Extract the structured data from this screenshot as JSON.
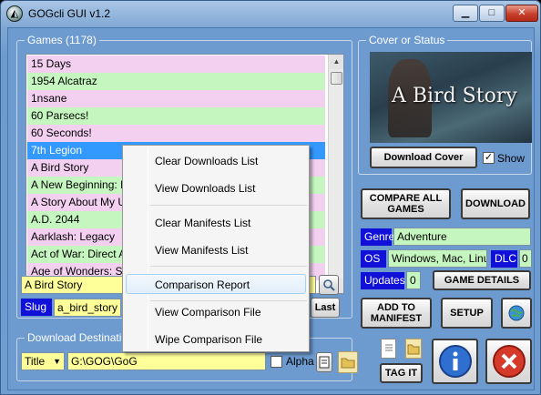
{
  "window": {
    "title": "GOGcli GUI v1.2",
    "minimize_glyph": "▁",
    "maximize_glyph": "□",
    "close_glyph": "✕"
  },
  "games": {
    "group_label": "Games  (1178)",
    "rows": [
      {
        "label": "15 Days",
        "style": "pink"
      },
      {
        "label": "1954 Alcatraz",
        "style": "green"
      },
      {
        "label": "1nsane",
        "style": "pink"
      },
      {
        "label": "60 Parsecs!",
        "style": "green"
      },
      {
        "label": "60 Seconds!",
        "style": "pink"
      },
      {
        "label": "7th Legion",
        "style": "sel"
      },
      {
        "label": "A Bird Story",
        "style": "pink"
      },
      {
        "label": "A New Beginning: F",
        "style": "green"
      },
      {
        "label": "A Story About My U",
        "style": "pink"
      },
      {
        "label": "A.D. 2044",
        "style": "green"
      },
      {
        "label": "Aarklash: Legacy",
        "style": "pink"
      },
      {
        "label": "Act of War: Direct A",
        "style": "green"
      },
      {
        "label": "Age of Wonders: Sh",
        "style": "pink"
      }
    ],
    "title_field": "A Bird Story",
    "slug_label": "Slug",
    "slug_value": "a_bird_story",
    "last_button": "Last"
  },
  "context_menu": {
    "items": [
      {
        "label": "Clear Downloads List"
      },
      {
        "label": "View Downloads List"
      },
      {
        "label": "Clear Manifests List"
      },
      {
        "label": "View Manifests List"
      },
      {
        "label": "Comparison Report"
      },
      {
        "label": "View Comparison File"
      },
      {
        "label": "Wipe Comparison File"
      }
    ]
  },
  "download": {
    "group_label": "Download Destination -",
    "title_option": "Title",
    "path": "G:\\GOG\\GoG",
    "alpha_label": "Alpha"
  },
  "cover": {
    "group_label": "Cover or Status",
    "image_title": "A Bird Story",
    "download_cover": "Download Cover",
    "show_label": "Show",
    "show_checked": "✓"
  },
  "actions": {
    "compare_all": "COMPARE ALL GAMES",
    "download": "DOWNLOAD",
    "genre_label": "Genre",
    "genre_value": "Adventure",
    "os_label": "OS",
    "os_value": "Windows, Mac, Linux",
    "dlc_label": "DLC",
    "dlc_value": "0",
    "updates_label": "Updates",
    "updates_value": "0",
    "game_details": "GAME DETAILS",
    "add_manifest": "ADD TO MANIFEST",
    "setup": "SETUP",
    "tag_it": "TAG IT"
  },
  "colors": {
    "accent_blue": "#1010d8",
    "row_pink": "#f3cff0",
    "row_green": "#c6f6c0",
    "selected": "#3399ff"
  }
}
